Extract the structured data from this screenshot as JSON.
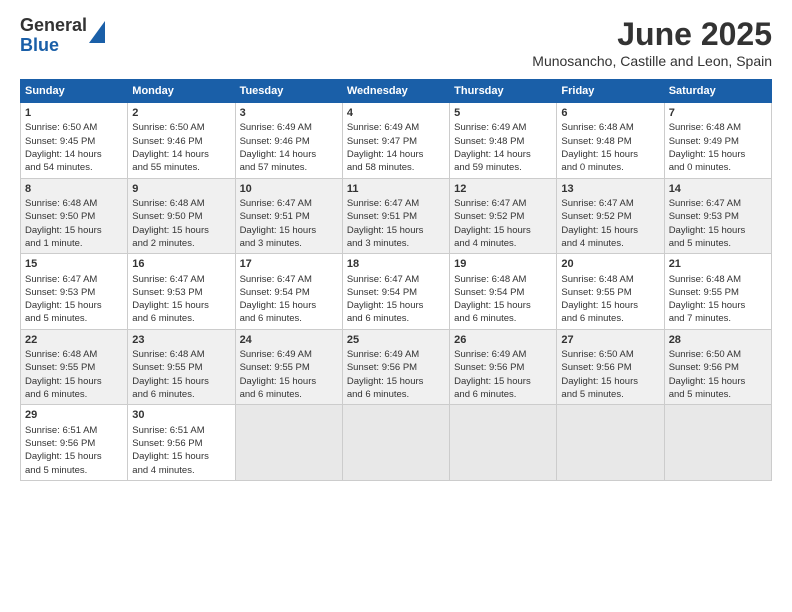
{
  "logo": {
    "line1": "General",
    "line2": "Blue"
  },
  "title": "June 2025",
  "subtitle": "Munosancho, Castille and Leon, Spain",
  "headers": [
    "Sunday",
    "Monday",
    "Tuesday",
    "Wednesday",
    "Thursday",
    "Friday",
    "Saturday"
  ],
  "weeks": [
    [
      {
        "day": "1",
        "info": "Sunrise: 6:50 AM\nSunset: 9:45 PM\nDaylight: 14 hours\nand 54 minutes."
      },
      {
        "day": "2",
        "info": "Sunrise: 6:50 AM\nSunset: 9:46 PM\nDaylight: 14 hours\nand 55 minutes."
      },
      {
        "day": "3",
        "info": "Sunrise: 6:49 AM\nSunset: 9:46 PM\nDaylight: 14 hours\nand 57 minutes."
      },
      {
        "day": "4",
        "info": "Sunrise: 6:49 AM\nSunset: 9:47 PM\nDaylight: 14 hours\nand 58 minutes."
      },
      {
        "day": "5",
        "info": "Sunrise: 6:49 AM\nSunset: 9:48 PM\nDaylight: 14 hours\nand 59 minutes."
      },
      {
        "day": "6",
        "info": "Sunrise: 6:48 AM\nSunset: 9:48 PM\nDaylight: 15 hours\nand 0 minutes."
      },
      {
        "day": "7",
        "info": "Sunrise: 6:48 AM\nSunset: 9:49 PM\nDaylight: 15 hours\nand 0 minutes."
      }
    ],
    [
      {
        "day": "8",
        "info": "Sunrise: 6:48 AM\nSunset: 9:50 PM\nDaylight: 15 hours\nand 1 minute."
      },
      {
        "day": "9",
        "info": "Sunrise: 6:48 AM\nSunset: 9:50 PM\nDaylight: 15 hours\nand 2 minutes."
      },
      {
        "day": "10",
        "info": "Sunrise: 6:47 AM\nSunset: 9:51 PM\nDaylight: 15 hours\nand 3 minutes."
      },
      {
        "day": "11",
        "info": "Sunrise: 6:47 AM\nSunset: 9:51 PM\nDaylight: 15 hours\nand 3 minutes."
      },
      {
        "day": "12",
        "info": "Sunrise: 6:47 AM\nSunset: 9:52 PM\nDaylight: 15 hours\nand 4 minutes."
      },
      {
        "day": "13",
        "info": "Sunrise: 6:47 AM\nSunset: 9:52 PM\nDaylight: 15 hours\nand 4 minutes."
      },
      {
        "day": "14",
        "info": "Sunrise: 6:47 AM\nSunset: 9:53 PM\nDaylight: 15 hours\nand 5 minutes."
      }
    ],
    [
      {
        "day": "15",
        "info": "Sunrise: 6:47 AM\nSunset: 9:53 PM\nDaylight: 15 hours\nand 5 minutes."
      },
      {
        "day": "16",
        "info": "Sunrise: 6:47 AM\nSunset: 9:53 PM\nDaylight: 15 hours\nand 6 minutes."
      },
      {
        "day": "17",
        "info": "Sunrise: 6:47 AM\nSunset: 9:54 PM\nDaylight: 15 hours\nand 6 minutes."
      },
      {
        "day": "18",
        "info": "Sunrise: 6:47 AM\nSunset: 9:54 PM\nDaylight: 15 hours\nand 6 minutes."
      },
      {
        "day": "19",
        "info": "Sunrise: 6:48 AM\nSunset: 9:54 PM\nDaylight: 15 hours\nand 6 minutes."
      },
      {
        "day": "20",
        "info": "Sunrise: 6:48 AM\nSunset: 9:55 PM\nDaylight: 15 hours\nand 6 minutes."
      },
      {
        "day": "21",
        "info": "Sunrise: 6:48 AM\nSunset: 9:55 PM\nDaylight: 15 hours\nand 7 minutes."
      }
    ],
    [
      {
        "day": "22",
        "info": "Sunrise: 6:48 AM\nSunset: 9:55 PM\nDaylight: 15 hours\nand 6 minutes."
      },
      {
        "day": "23",
        "info": "Sunrise: 6:48 AM\nSunset: 9:55 PM\nDaylight: 15 hours\nand 6 minutes."
      },
      {
        "day": "24",
        "info": "Sunrise: 6:49 AM\nSunset: 9:55 PM\nDaylight: 15 hours\nand 6 minutes."
      },
      {
        "day": "25",
        "info": "Sunrise: 6:49 AM\nSunset: 9:56 PM\nDaylight: 15 hours\nand 6 minutes."
      },
      {
        "day": "26",
        "info": "Sunrise: 6:49 AM\nSunset: 9:56 PM\nDaylight: 15 hours\nand 6 minutes."
      },
      {
        "day": "27",
        "info": "Sunrise: 6:50 AM\nSunset: 9:56 PM\nDaylight: 15 hours\nand 5 minutes."
      },
      {
        "day": "28",
        "info": "Sunrise: 6:50 AM\nSunset: 9:56 PM\nDaylight: 15 hours\nand 5 minutes."
      }
    ],
    [
      {
        "day": "29",
        "info": "Sunrise: 6:51 AM\nSunset: 9:56 PM\nDaylight: 15 hours\nand 5 minutes."
      },
      {
        "day": "30",
        "info": "Sunrise: 6:51 AM\nSunset: 9:56 PM\nDaylight: 15 hours\nand 4 minutes."
      },
      {
        "day": "",
        "info": ""
      },
      {
        "day": "",
        "info": ""
      },
      {
        "day": "",
        "info": ""
      },
      {
        "day": "",
        "info": ""
      },
      {
        "day": "",
        "info": ""
      }
    ]
  ]
}
